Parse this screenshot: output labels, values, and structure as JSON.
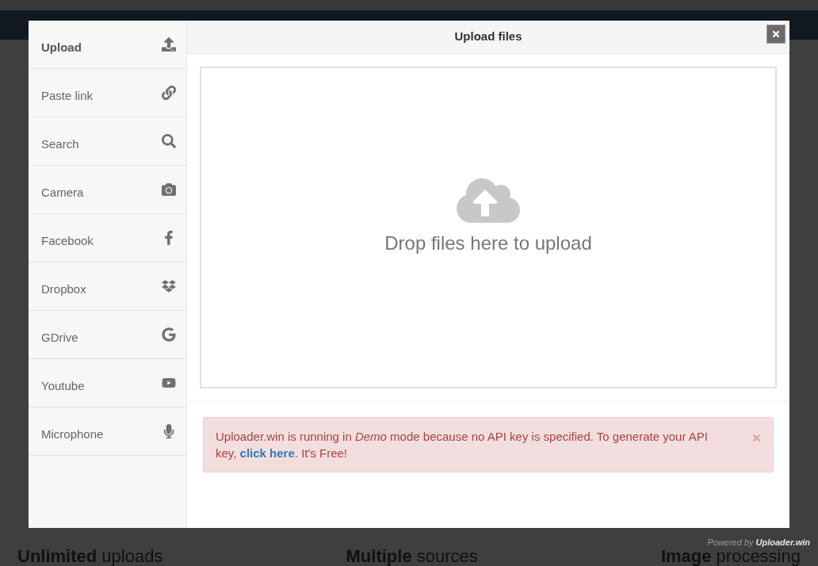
{
  "dialog": {
    "title": "Upload files"
  },
  "sidebar": {
    "items": [
      {
        "label": "Upload",
        "kind": "upload",
        "selected": true
      },
      {
        "label": "Paste link",
        "kind": "link",
        "selected": false
      },
      {
        "label": "Search",
        "kind": "search",
        "selected": false
      },
      {
        "label": "Camera",
        "kind": "camera",
        "selected": false
      },
      {
        "label": "Facebook",
        "kind": "facebook",
        "selected": false
      },
      {
        "label": "Dropbox",
        "kind": "dropbox",
        "selected": false
      },
      {
        "label": "GDrive",
        "kind": "gdrive",
        "selected": false
      },
      {
        "label": "Youtube",
        "kind": "youtube",
        "selected": false
      },
      {
        "label": "Microphone",
        "kind": "microphone",
        "selected": false
      }
    ]
  },
  "dropzone": {
    "text": "Drop files here to upload"
  },
  "alert": {
    "text_before": "Uploader.win is running in *Demo* mode because no API key is specified. To generate your API key,",
    "link": "click here",
    "text_after": ". It's Free!"
  },
  "powered_by": {
    "label": "Powered by",
    "brand": "Uploader.win"
  },
  "features": [
    "**Unlimited** uploads",
    "**Multiple** sources",
    "**Image** processing"
  ]
}
